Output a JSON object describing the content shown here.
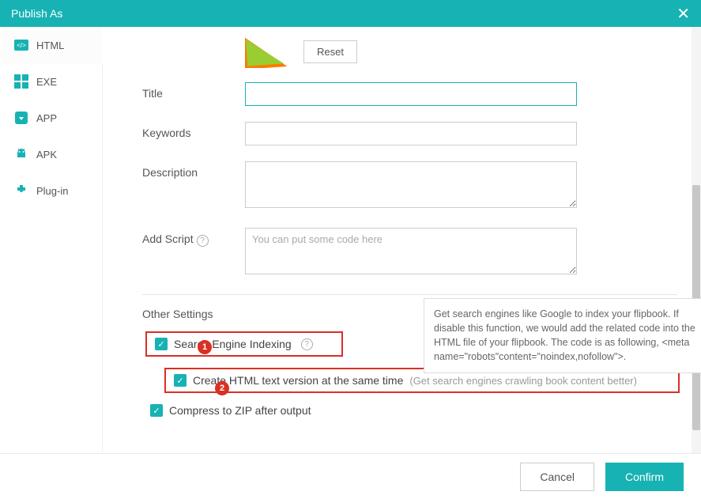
{
  "window": {
    "title": "Publish As"
  },
  "sidebar": {
    "items": [
      {
        "label": "HTML"
      },
      {
        "label": "EXE"
      },
      {
        "label": "APP"
      },
      {
        "label": "APK"
      },
      {
        "label": "Plug-in"
      }
    ]
  },
  "form": {
    "reset_label": "Reset",
    "title_label": "Title",
    "keywords_label": "Keywords",
    "description_label": "Description",
    "addscript_label": "Add Script",
    "addscript_placeholder": "You can put some code here"
  },
  "other": {
    "section_title": "Other Settings",
    "sei_label": "Search Engine Indexing",
    "createhtml_label": "Create HTML text version at the same time",
    "createhtml_hint": "(Get search engines crawling book content better)",
    "compress_label": "Compress to ZIP after output"
  },
  "tooltip": {
    "text": " Get search engines like Google to index your flipbook. If disable this function, we would add the related code into the HTML file of your flipbook. The code is as following, <meta name=\"robots\"content=\"noindex,nofollow\">."
  },
  "badges": {
    "b1": "1",
    "b2": "2"
  },
  "footer": {
    "cancel": "Cancel",
    "confirm": "Confirm"
  }
}
